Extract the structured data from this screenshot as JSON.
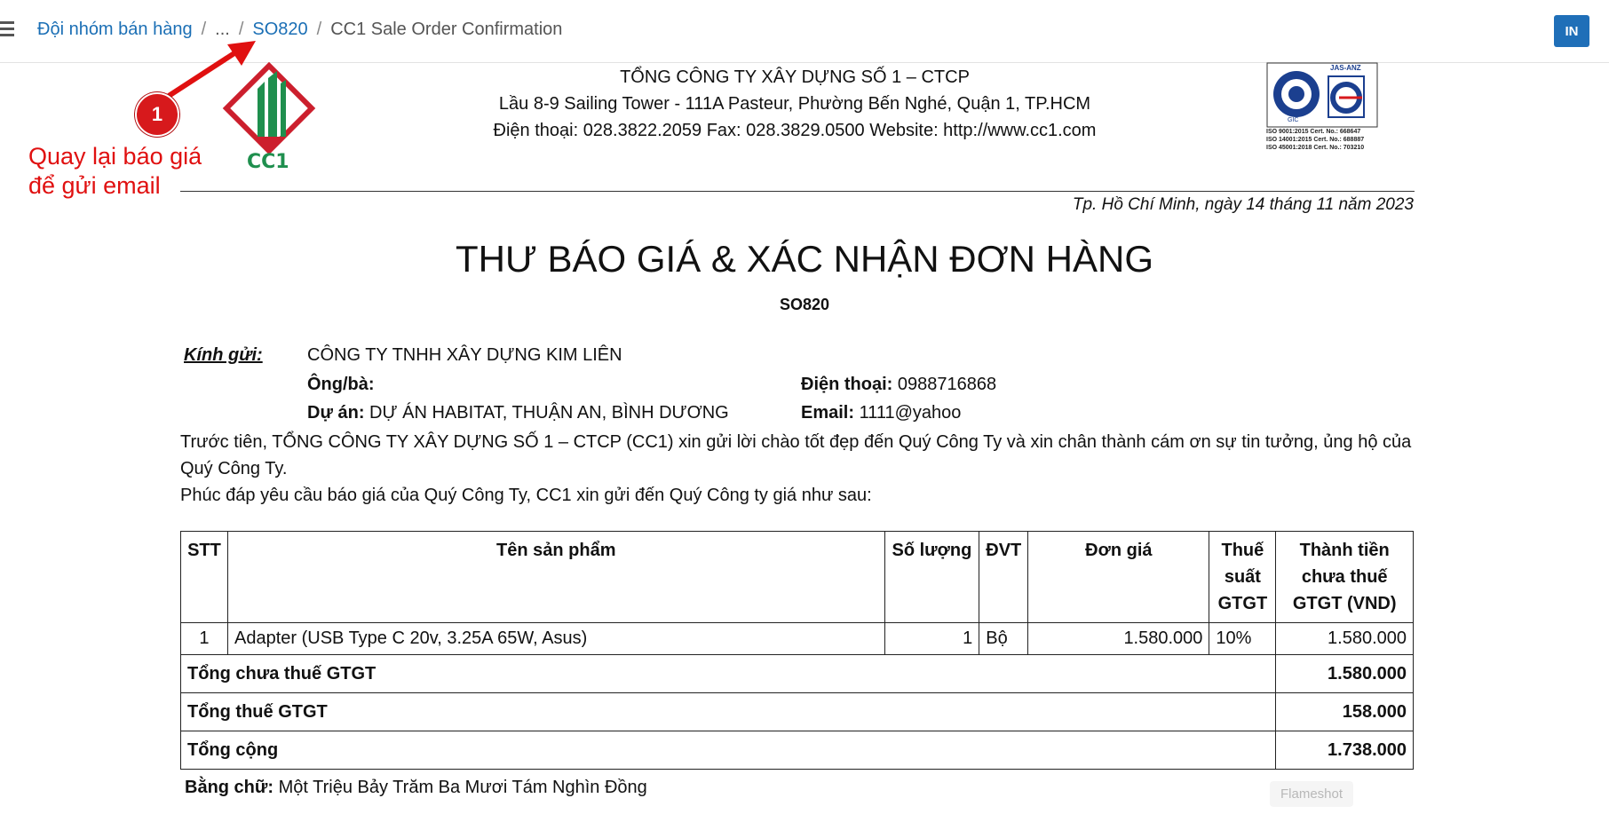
{
  "breadcrumb": {
    "item1": "Đội nhóm bán hàng",
    "sep": "/",
    "item2": "...",
    "item3": "SO820",
    "item4": "CC1 Sale Order Confirmation"
  },
  "toolbar": {
    "print_label": "IN"
  },
  "annotation": {
    "number": "1",
    "line1": "Quay lại báo giá",
    "line2": "để gửi email"
  },
  "logo": {
    "text": "CC1"
  },
  "company": {
    "name": "TỔNG CÔNG TY XÂY DỰNG SỐ 1 – CTCP",
    "address": "Lầu 8-9 Sailing Tower - 111A Pasteur, Phường Bến Nghé, Quận 1, TP.HCM",
    "contact": "Điện thoại: 028.3822.2059 Fax: 028.3829.0500 Website: http://www.cc1.com"
  },
  "iso": {
    "badge": "JAS-ANZ",
    "brand": "GIC",
    "line1": "ISO 9001:2015  Cert. No.: 668647",
    "line2": "ISO 14001:2015  Cert. No.: 688887",
    "line3": "ISO 45001:2018  Cert. No.: 703210"
  },
  "doc": {
    "date": "Tp. Hồ Chí Minh, ngày 14 tháng 11 năm 2023",
    "title": "THƯ BÁO GIÁ & XÁC NHẬN ĐƠN HÀNG",
    "code": "SO820"
  },
  "recipient": {
    "kinh_gui_label": "Kính gửi:",
    "customer": "CÔNG TY TNHH XÂY DỰNG KIM LIÊN",
    "ongba_label": "Ông/bà:",
    "duan_label": "Dự án:",
    "duan_value": "DỰ ÁN HABITAT, THUẬN AN, BÌNH DƯƠNG",
    "phone_label": "Điện thoại:",
    "phone_value": "0988716868",
    "email_label": "Email:",
    "email_value": "1111@yahoo"
  },
  "paragraphs": {
    "p1": "Trước tiên, TỔNG CÔNG TY XÂY DỰNG SỐ 1 – CTCP (CC1) xin gửi lời chào tốt đẹp đến Quý Công Ty và xin chân thành cám ơn sự tin tưởng, ủng hộ của Quý Công Ty.",
    "p2": "Phúc đáp yêu cầu báo giá của Quý Công Ty, CC1 xin gửi đến Quý Công ty giá như sau:"
  },
  "table": {
    "headers": {
      "stt": "STT",
      "name": "Tên sản phẩm",
      "qty": "Số lượng",
      "unit": "ĐVT",
      "price": "Đơn giá",
      "vat": "Thuế suất GTGT",
      "total": "Thành tiền chưa thuế GTGT (VND)"
    },
    "rows": [
      {
        "stt": "1",
        "name": "Adapter (USB Type C 20v, 3.25A 65W, Asus)",
        "qty": "1",
        "unit": "Bộ",
        "price": "1.580.000",
        "vat": "10%",
        "total": "1.580.000"
      }
    ],
    "subtotal_label": "Tổng chưa thuế GTGT",
    "subtotal_value": "1.580.000",
    "vat_label": "Tổng thuế GTGT",
    "vat_value": "158.000",
    "grand_label": "Tổng cộng",
    "grand_value": "1.738.000"
  },
  "amount_words": {
    "label": "Bằng chữ:",
    "value": "Một Triệu Bảy Trăm Ba Mươi Tám Nghìn Đồng"
  },
  "overlay": {
    "flameshot": "Flameshot"
  }
}
